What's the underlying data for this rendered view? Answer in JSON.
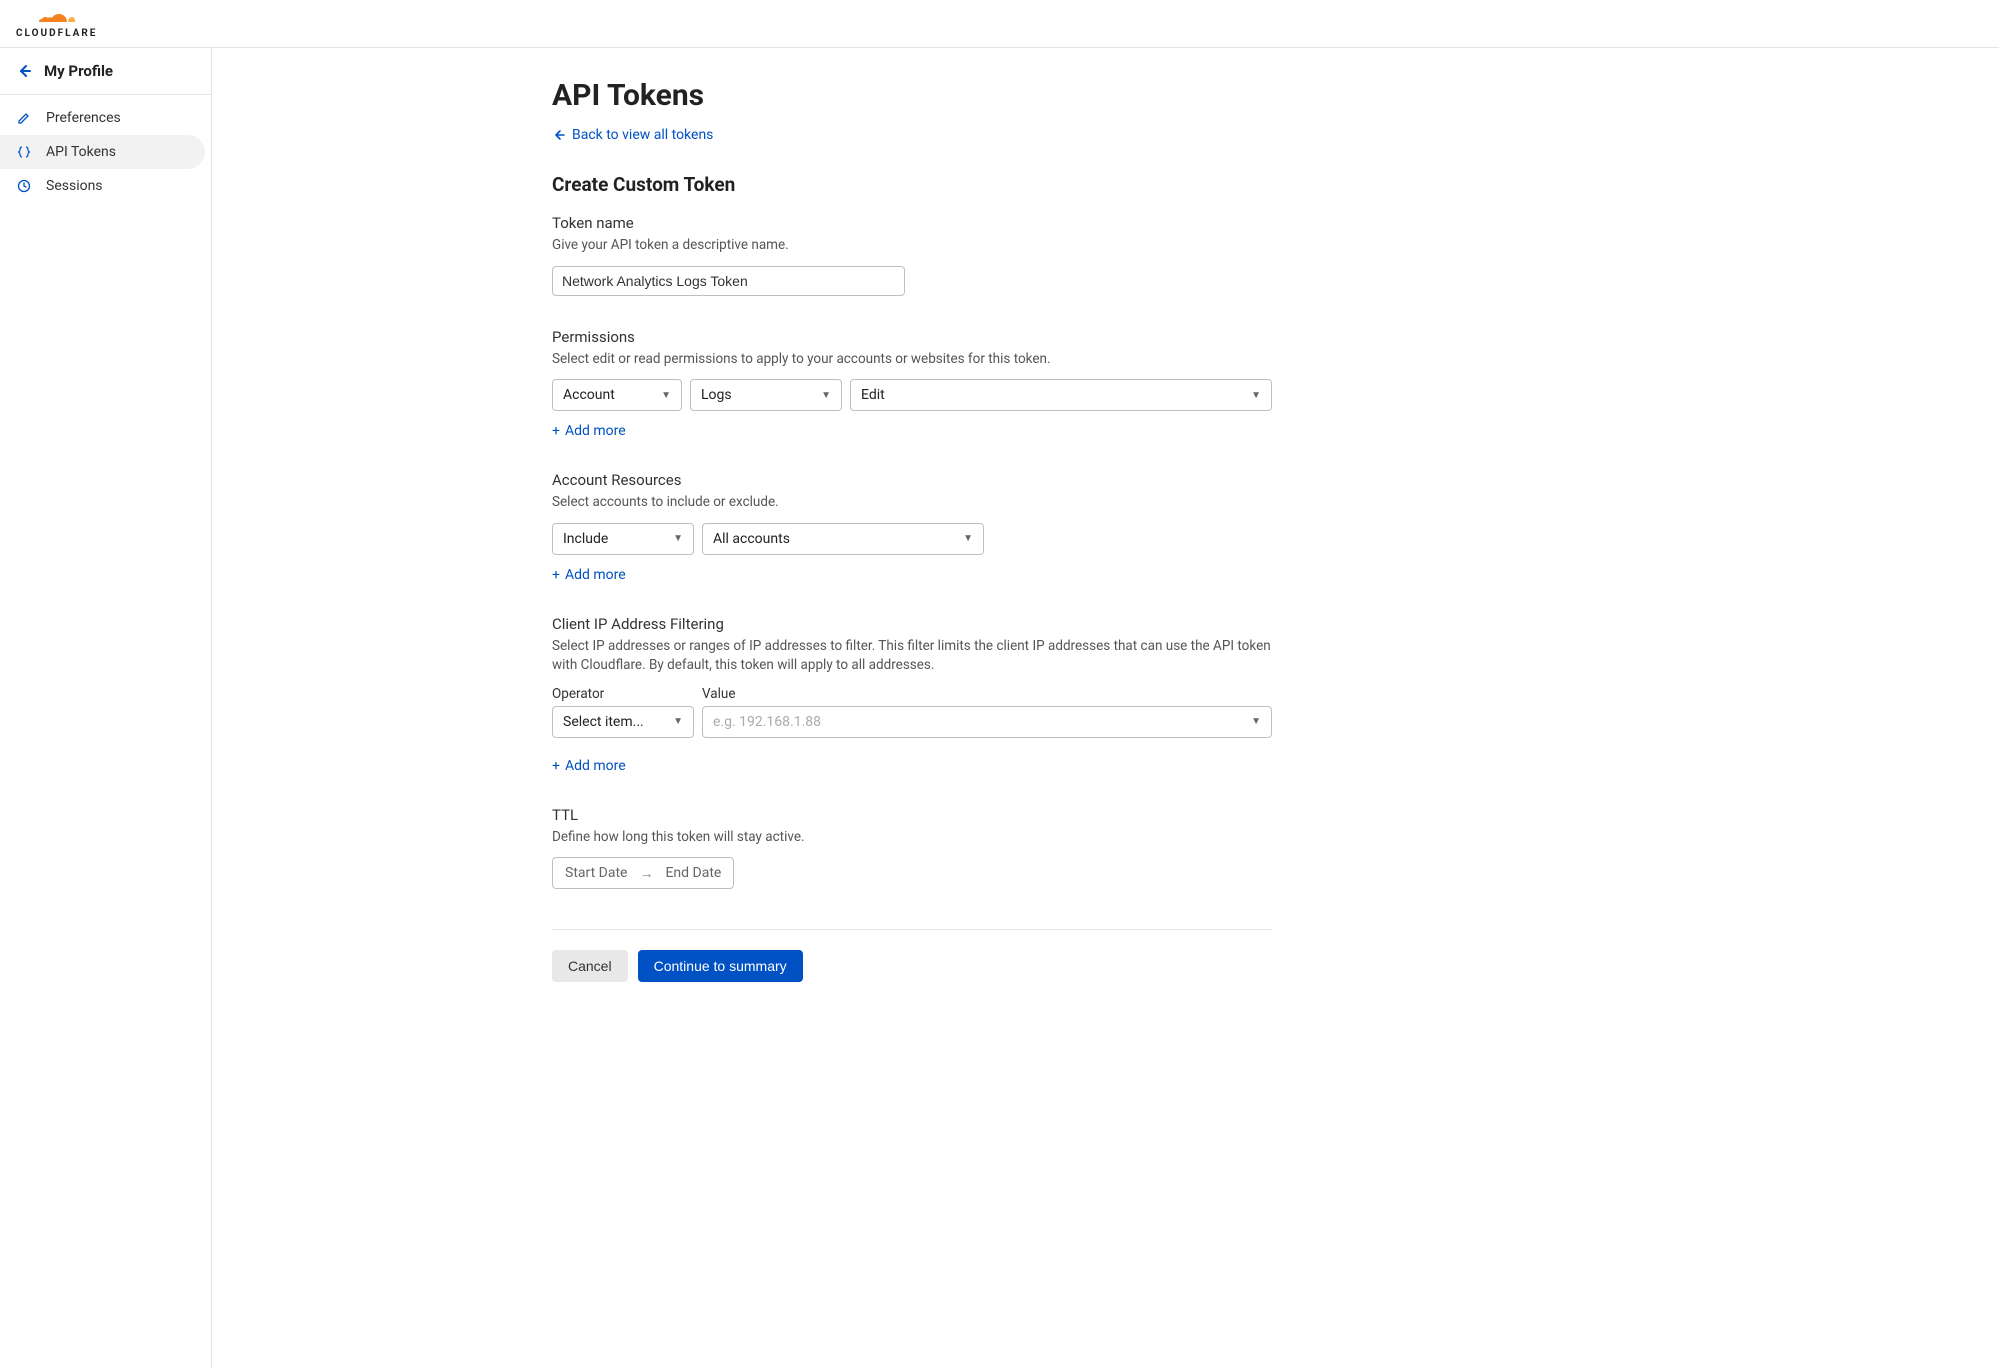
{
  "brand": "CLOUDFLARE",
  "sidebar": {
    "title": "My Profile",
    "items": [
      {
        "label": "Preferences"
      },
      {
        "label": "API Tokens"
      },
      {
        "label": "Sessions"
      }
    ]
  },
  "page": {
    "title": "API Tokens",
    "back_link": "Back to view all tokens",
    "create_title": "Create Custom Token"
  },
  "token_name": {
    "label": "Token name",
    "desc": "Give your API token a descriptive name.",
    "value": "Network Analytics Logs Token"
  },
  "permissions": {
    "label": "Permissions",
    "desc": "Select edit or read permissions to apply to your accounts or websites for this token.",
    "scope": "Account",
    "resource": "Logs",
    "level": "Edit",
    "add_more": "Add more"
  },
  "account_resources": {
    "label": "Account Resources",
    "desc": "Select accounts to include or exclude.",
    "mode": "Include",
    "target": "All accounts",
    "add_more": "Add more"
  },
  "ip_filter": {
    "label": "Client IP Address Filtering",
    "desc": "Select IP addresses or ranges of IP addresses to filter. This filter limits the client IP addresses that can use the API token with Cloudflare. By default, this token will apply to all addresses.",
    "operator_label": "Operator",
    "value_label": "Value",
    "operator": "Select item...",
    "value_placeholder": "e.g. 192.168.1.88",
    "add_more": "Add more"
  },
  "ttl": {
    "label": "TTL",
    "desc": "Define how long this token will stay active.",
    "start": "Start Date",
    "end": "End Date"
  },
  "actions": {
    "cancel": "Cancel",
    "continue": "Continue to summary"
  }
}
